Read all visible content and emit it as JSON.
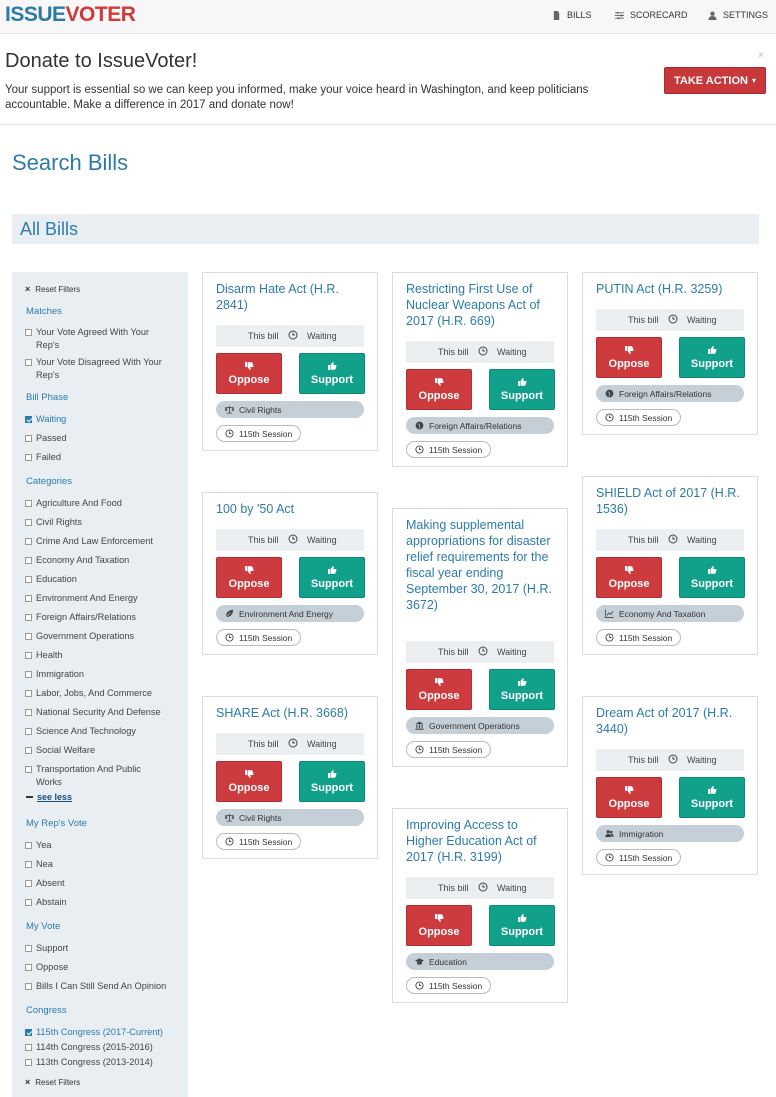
{
  "app": {
    "logo_part1": "ISSUE",
    "logo_part2": "VOTER"
  },
  "nav": {
    "bills": "BILLS",
    "scorecard": "SCORECARD",
    "settings": "SETTINGS"
  },
  "donate": {
    "title": "Donate to IssueVoter!",
    "text": "Your support is essential so we can keep you informed, make your voice heard in Washington, and keep politicians accountable. Make a difference in 2017 and donate now!",
    "close": "×",
    "action": "TAKE ACTION",
    "action_caret": "▾"
  },
  "page_title": "Search Bills",
  "section_title": "All Bills",
  "filters": {
    "reset": "Reset Filters",
    "matches_heading": "Matches",
    "matches": [
      {
        "label": "Your Vote Agreed With Your Rep's",
        "checked": false
      },
      {
        "label": "Your Vote Disagreed With Your Rep's",
        "checked": false
      }
    ],
    "phase_heading": "Bill Phase",
    "phases": [
      {
        "label": "Waiting",
        "checked": true
      },
      {
        "label": "Passed",
        "checked": false
      },
      {
        "label": "Failed",
        "checked": false
      }
    ],
    "categories_heading": "Categories",
    "categories": [
      {
        "label": "Agriculture And Food",
        "checked": false
      },
      {
        "label": "Civil Rights",
        "checked": false
      },
      {
        "label": "Crime And Law Enforcement",
        "checked": false
      },
      {
        "label": "Economy And Taxation",
        "checked": false
      },
      {
        "label": "Education",
        "checked": false
      },
      {
        "label": "Environment And Energy",
        "checked": false
      },
      {
        "label": "Foreign Affairs/Relations",
        "checked": false
      },
      {
        "label": "Government Operations",
        "checked": false
      },
      {
        "label": "Health",
        "checked": false
      },
      {
        "label": "Immigration",
        "checked": false
      },
      {
        "label": "Labor, Jobs, And Commerce",
        "checked": false
      },
      {
        "label": "National Security And Defense",
        "checked": false
      },
      {
        "label": "Science And Technology",
        "checked": false
      },
      {
        "label": "Social Welfare",
        "checked": false
      },
      {
        "label": "Transportation And Public Works",
        "checked": false
      }
    ],
    "see_less": "see less",
    "rep_vote_heading": "My Rep's Vote",
    "rep_votes": [
      {
        "label": "Yea",
        "checked": false
      },
      {
        "label": "Nea",
        "checked": false
      },
      {
        "label": "Absent",
        "checked": false
      },
      {
        "label": "Abstain",
        "checked": false
      }
    ],
    "my_vote_heading": "My Vote",
    "my_votes": [
      {
        "label": "Support",
        "checked": false
      },
      {
        "label": "Oppose",
        "checked": false
      },
      {
        "label": "Bills I Can Still Send An Opinion",
        "checked": false
      }
    ],
    "congress_heading": "Congress",
    "congresses": [
      {
        "label": "115th Congress (2017-Current)",
        "checked": true
      },
      {
        "label": "114th Congress (2015-2016)",
        "checked": false
      },
      {
        "label": "113th Congress (2013-2014)",
        "checked": false
      }
    ]
  },
  "card_common": {
    "this_bill": "This bill",
    "oppose": "Oppose",
    "support": "Support"
  },
  "cards": [
    {
      "title": "Disarm Hate Act (H.R. 2841)",
      "status": "Waiting",
      "category": "Civil Rights",
      "category_icon": "scale-icon",
      "session": "115th Session"
    },
    {
      "title": "100 by '50 Act",
      "status": "Waiting",
      "category": "Environment And Energy",
      "category_icon": "leaf-icon",
      "session": "115th Session"
    },
    {
      "title": "SHARE Act (H.R. 3668)",
      "status": "Waiting",
      "category": "Civil Rights",
      "category_icon": "scale-icon",
      "session": "115th Session"
    },
    {
      "title": "Restricting First Use of Nuclear Weapons Act of 2017 (H.R. 669)",
      "status": "Waiting",
      "category": "Foreign Affairs/Relations",
      "category_icon": "globe-icon",
      "session": "115th Session"
    },
    {
      "title": "Making supplemental appropriations for disaster relief requirements for the fiscal year ending September 30, 2017 (H.R. 3672)",
      "status": "Waiting",
      "category": "Government Operations",
      "category_icon": "bank-icon",
      "session": "115th Session"
    },
    {
      "title": "Improving Access to Higher Education Act of 2017 (H.R. 3199)",
      "status": "Waiting",
      "category": "Education",
      "category_icon": "graduation-cap-icon",
      "session": "115th Session"
    },
    {
      "title": "PUTIN Act (H.R. 3259)",
      "status": "Waiting",
      "category": "Foreign Affairs/Relations",
      "category_icon": "globe-icon",
      "session": "115th Session"
    },
    {
      "title": "SHIELD Act of 2017 (H.R. 1536)",
      "status": "Waiting",
      "category": "Economy And Taxation",
      "category_icon": "line-chart-icon",
      "session": "115th Session"
    },
    {
      "title": "Dream Act of 2017 (H.R. 3440)",
      "status": "Waiting",
      "category": "Immigration",
      "category_icon": "users-icon",
      "session": "115th Session"
    }
  ]
}
